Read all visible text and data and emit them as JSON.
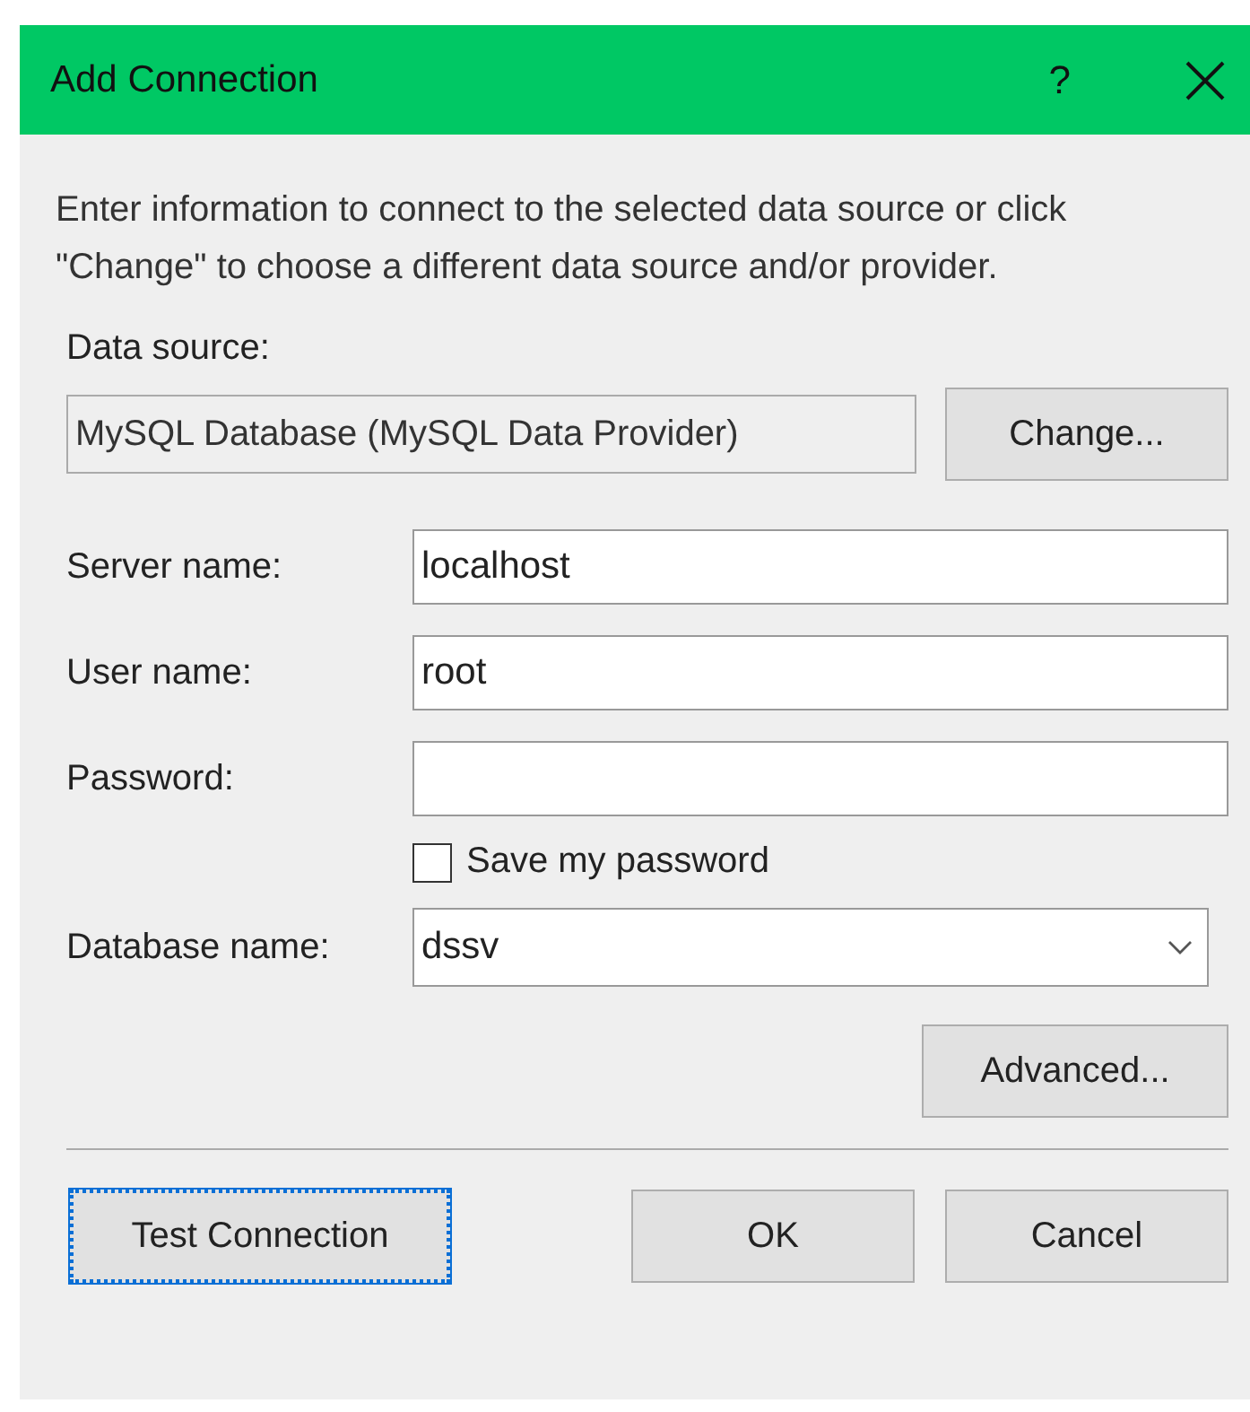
{
  "window": {
    "title": "Add Connection",
    "help": "?"
  },
  "intro": "Enter information to connect to the selected data source or click \"Change\" to choose a different data source and/or provider.",
  "data_source": {
    "label": "Data source:",
    "value": "MySQL Database (MySQL Data Provider)",
    "button": "Change..."
  },
  "fields": [
    {
      "kind": "text",
      "label": "Server name:",
      "value": "localhost"
    },
    {
      "kind": "text",
      "label": "User name:",
      "value": "root"
    },
    {
      "kind": "password",
      "label": "Password:"
    },
    {
      "kind": "checkbox",
      "label": "Save my password",
      "checked": false
    },
    {
      "kind": "combo",
      "label": "Database name:",
      "value": "dssv"
    }
  ],
  "advanced_button": "Advanced...",
  "buttons": [
    {
      "label": "Test Connection",
      "focused": true
    },
    {
      "label": "OK",
      "focused": false
    },
    {
      "label": "Cancel",
      "focused": false
    }
  ]
}
